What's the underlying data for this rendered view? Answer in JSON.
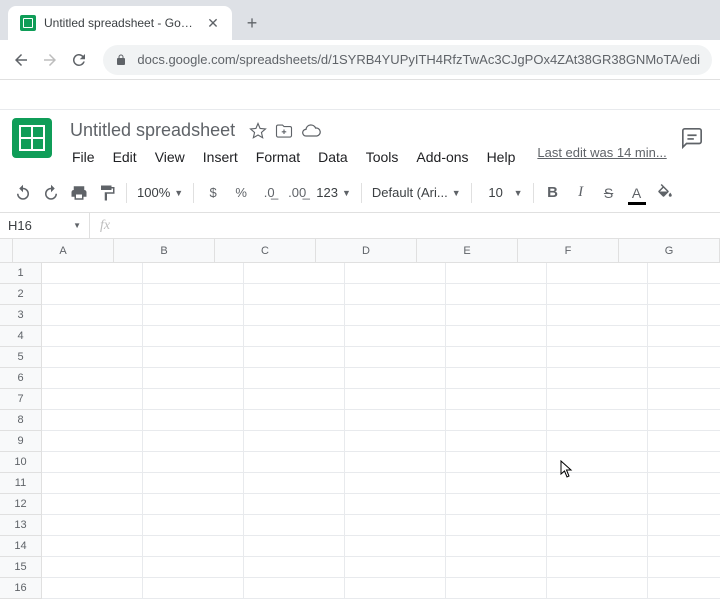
{
  "browser": {
    "tab_title": "Untitled spreadsheet - Google Sh",
    "url": "docs.google.com/spreadsheets/d/1SYRB4YUPyITH4RfzTwAc3CJgPOx4ZAt38GR38GNMoTA/edi"
  },
  "doc": {
    "title": "Untitled spreadsheet",
    "last_edit": "Last edit was 14 min..."
  },
  "menus": [
    "File",
    "Edit",
    "View",
    "Insert",
    "Format",
    "Data",
    "Tools",
    "Add-ons",
    "Help"
  ],
  "toolbar": {
    "zoom": "100%",
    "font": "Default (Ari...",
    "font_size": "10",
    "num_fmt": "123"
  },
  "name_box": "H16",
  "columns": [
    "A",
    "B",
    "C",
    "D",
    "E",
    "F",
    "G"
  ],
  "rows": [
    "1",
    "2",
    "3",
    "4",
    "5",
    "6",
    "7",
    "8",
    "9",
    "10",
    "11",
    "12",
    "13",
    "14",
    "15",
    "16"
  ]
}
